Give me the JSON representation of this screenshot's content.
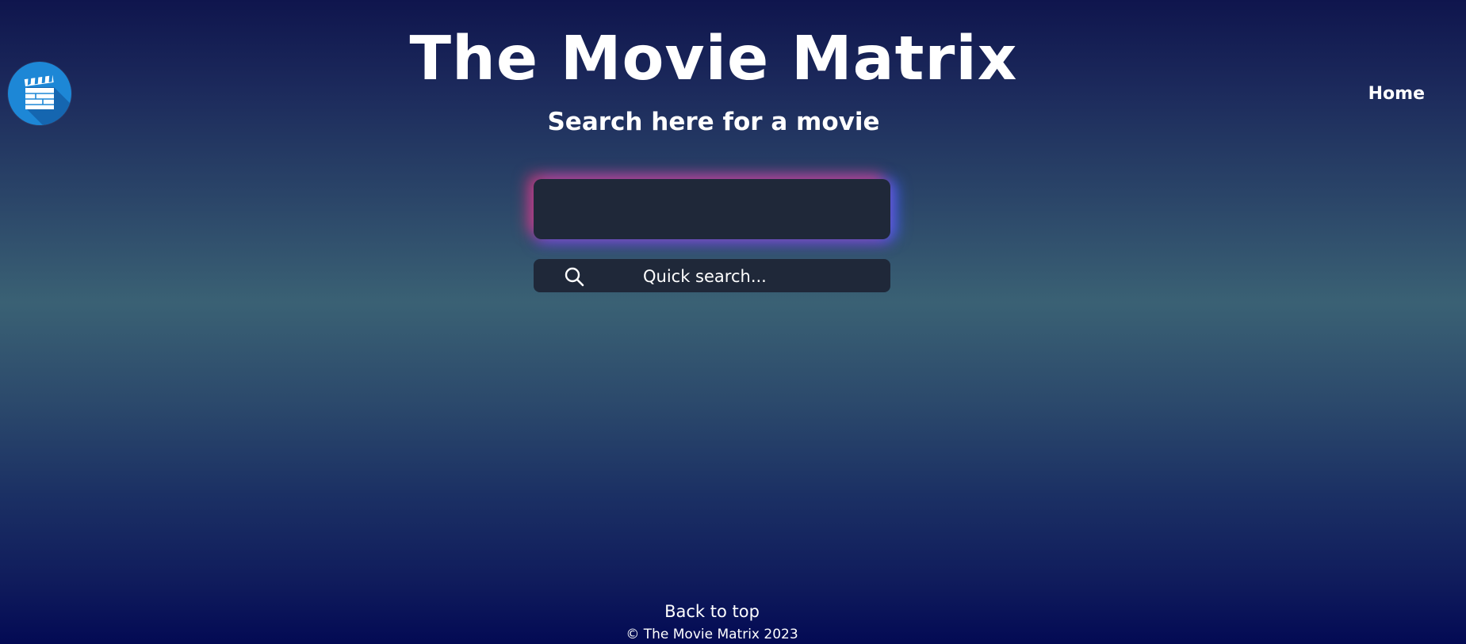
{
  "header": {
    "title": "The Movie Matrix",
    "subtitle": "Search here for a movie",
    "logo_icon": "clapperboard-icon"
  },
  "nav": {
    "home_label": "Home"
  },
  "search": {
    "value": "",
    "placeholder": ""
  },
  "quick_search": {
    "icon": "search-icon",
    "label": "Quick search..."
  },
  "footer": {
    "back_to_top": "Back to top",
    "copyright": "© The Movie Matrix 2023"
  },
  "colors": {
    "logo_bg": "#1d87d6",
    "input_bg": "#1f2839",
    "glow_pink": "#e23a78",
    "glow_blue": "#4664ff"
  }
}
